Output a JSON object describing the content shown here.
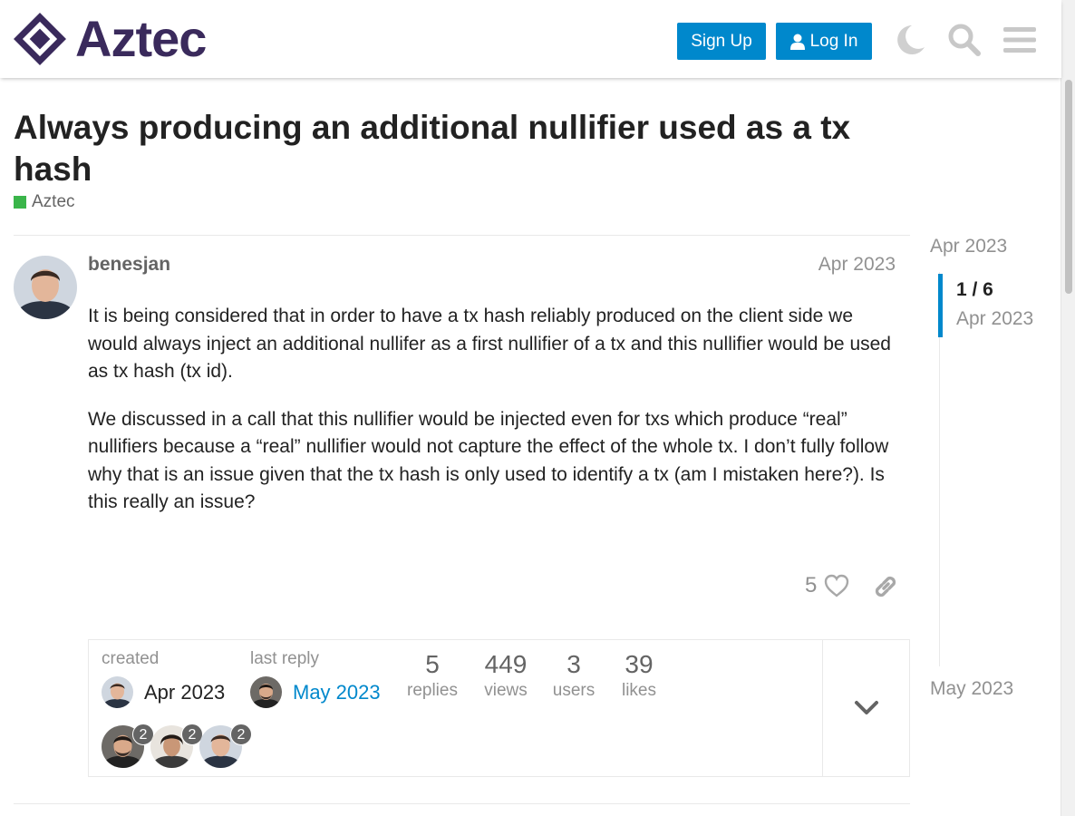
{
  "header": {
    "logo_text": "Aztec",
    "signup_label": "Sign Up",
    "login_label": "Log In",
    "icons": [
      "moon-icon",
      "search-icon",
      "hamburger-menu-icon"
    ]
  },
  "topic": {
    "title": "Always producing an additional nullifier used as a tx hash",
    "category": "Aztec",
    "category_color": "#3ab54a"
  },
  "post": {
    "username": "benesjan",
    "date": "Apr 2023",
    "paragraphs": [
      "It is being considered that in order to have a tx hash reliably produced on the client side we would always inject an additional nullifer as a first nullifier of a tx and this nullifier would be used as tx hash (tx id).",
      "We discussed in a call that this nullifier would be injected even for txs which produce “real” nullifiers because a “real” nullifier would not capture the effect of the whole tx. I don’t fully follow why that is an issue given that the tx hash is only used to identify a tx (am I mistaken here?). Is this really an issue?"
    ],
    "like_count": "5"
  },
  "topic_map": {
    "created_label": "created",
    "created_value": "Apr 2023",
    "last_reply_label": "last reply",
    "last_reply_value": "May 2023",
    "stats": [
      {
        "num": "5",
        "label": "replies"
      },
      {
        "num": "449",
        "label": "views"
      },
      {
        "num": "3",
        "label": "users"
      },
      {
        "num": "39",
        "label": "likes"
      }
    ],
    "participants": [
      {
        "count": "2"
      },
      {
        "count": "2"
      },
      {
        "count": "2"
      }
    ]
  },
  "timeline": {
    "top_date": "Apr 2023",
    "position": "1 / 6",
    "position_date": "Apr 2023",
    "bottom_date": "May 2023"
  },
  "colors": {
    "accent": "#0088cc",
    "brand": "#3a2a5c"
  }
}
